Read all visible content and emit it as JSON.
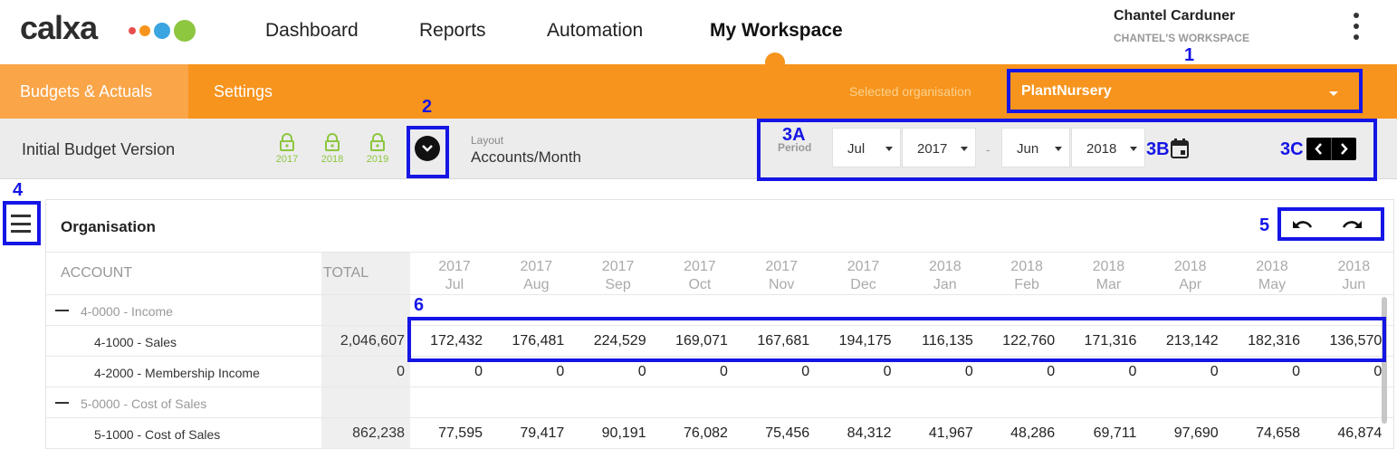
{
  "brand": {
    "name": "calxa",
    "dot_colors": [
      "#e94e4e",
      "#f7941d",
      "#3aa5e0",
      "#8dc63f"
    ]
  },
  "nav": {
    "items": [
      {
        "label": "Dashboard"
      },
      {
        "label": "Reports"
      },
      {
        "label": "Automation"
      },
      {
        "label": "My Workspace"
      }
    ]
  },
  "user": {
    "name": "Chantel Carduner",
    "workspace": "CHANTEL'S WORKSPACE"
  },
  "subnav": {
    "tabs": [
      {
        "label": "Budgets & Actuals"
      },
      {
        "label": "Settings"
      }
    ],
    "selected_org_label": "Selected organisation",
    "selected_org": "PlantNursery"
  },
  "toolbar": {
    "budget_version": "Initial Budget Version",
    "locks": [
      "2017",
      "2018",
      "2019"
    ],
    "layout_label": "Layout",
    "layout_value": "Accounts/Month",
    "period_label": "Period",
    "start_month": "Jul",
    "start_year": "2017",
    "separator": "-",
    "end_month": "Jun",
    "end_year": "2018"
  },
  "annotations": [
    "1",
    "2",
    "3A",
    "3B",
    "3C",
    "4",
    "5",
    "6"
  ],
  "grid": {
    "title": "Organisation",
    "col_account": "ACCOUNT",
    "col_total": "TOTAL",
    "months": [
      {
        "year": "2017",
        "month": "Jul"
      },
      {
        "year": "2017",
        "month": "Aug"
      },
      {
        "year": "2017",
        "month": "Sep"
      },
      {
        "year": "2017",
        "month": "Oct"
      },
      {
        "year": "2017",
        "month": "Nov"
      },
      {
        "year": "2017",
        "month": "Dec"
      },
      {
        "year": "2018",
        "month": "Jan"
      },
      {
        "year": "2018",
        "month": "Feb"
      },
      {
        "year": "2018",
        "month": "Mar"
      },
      {
        "year": "2018",
        "month": "Apr"
      },
      {
        "year": "2018",
        "month": "May"
      },
      {
        "year": "2018",
        "month": "Jun"
      }
    ],
    "rows": [
      {
        "label": "4-0000 - Income",
        "group": true,
        "total": "",
        "values": []
      },
      {
        "label": "4-1000 - Sales",
        "group": false,
        "total": "2,046,607",
        "values": [
          "172,432",
          "176,481",
          "224,529",
          "169,071",
          "167,681",
          "194,175",
          "116,135",
          "122,760",
          "171,316",
          "213,142",
          "182,316",
          "136,570"
        ]
      },
      {
        "label": "4-2000 - Membership Income",
        "group": false,
        "total": "0",
        "values": [
          "0",
          "0",
          "0",
          "0",
          "0",
          "0",
          "0",
          "0",
          "0",
          "0",
          "0",
          "0"
        ]
      },
      {
        "label": "5-0000 - Cost of Sales",
        "group": true,
        "total": "",
        "values": []
      },
      {
        "label": "5-1000 - Cost of Sales",
        "group": false,
        "total": "862,238",
        "values": [
          "77,595",
          "79,417",
          "90,191",
          "76,082",
          "75,456",
          "84,312",
          "41,967",
          "48,286",
          "69,711",
          "97,690",
          "74,658",
          "46,874"
        ]
      }
    ]
  }
}
